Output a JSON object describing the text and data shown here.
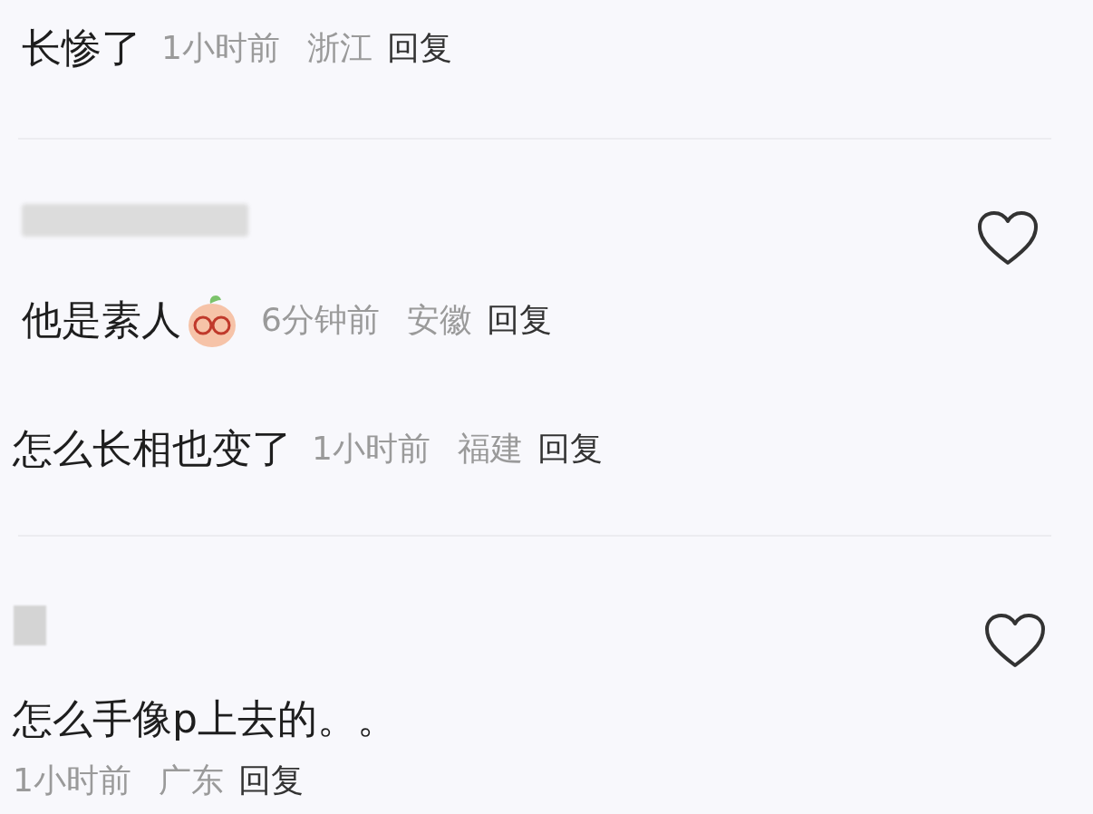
{
  "comments": [
    {
      "text": "长惨了",
      "time": "1小时前",
      "location": "浙江",
      "reply": "回复",
      "author_hidden": false,
      "like_button": false,
      "sticker": false
    },
    {
      "text": "他是素人",
      "time": "6分钟前",
      "location": "安徽",
      "reply": "回复",
      "author_hidden": true,
      "like_button": true,
      "sticker": true
    },
    {
      "text": "怎么长相也变了",
      "time": "1小时前",
      "location": "福建",
      "reply": "回复",
      "author_hidden": false,
      "like_button": false,
      "sticker": false
    },
    {
      "text": "怎么手像p上去的。。",
      "time": "1小时前",
      "location": "广东",
      "reply": "回复",
      "author_hidden": true,
      "like_button": true,
      "sticker": false
    }
  ]
}
